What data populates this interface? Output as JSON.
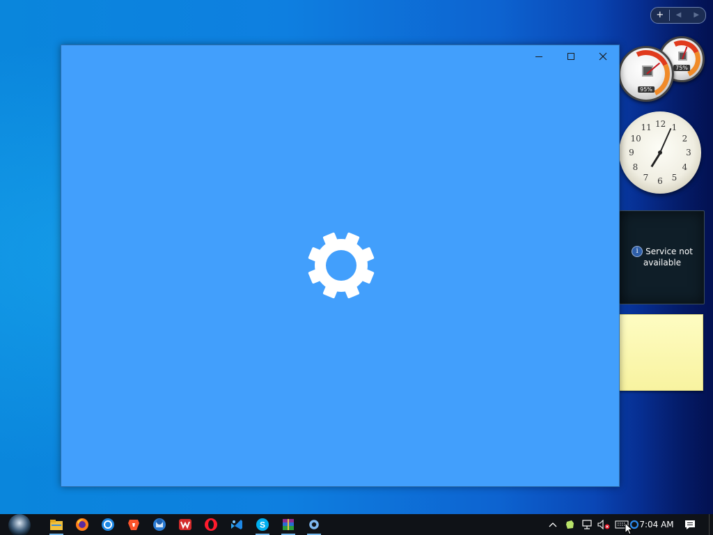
{
  "desktop": {
    "gadget_toolbar": {
      "add_label": "+",
      "prev_label": "◀",
      "next_label": "▶"
    },
    "meters": [
      {
        "percent": "95%"
      },
      {
        "percent": "75%"
      }
    ],
    "clock_gadget": {
      "numbers": [
        "12",
        "1",
        "2",
        "3",
        "4",
        "5",
        "6",
        "7",
        "8",
        "9",
        "10",
        "11"
      ],
      "hour": 7,
      "minute": 4
    },
    "weather_gadget": {
      "message": "Service not available",
      "info_glyph": "i"
    }
  },
  "window": {
    "background_color": "#429ffc",
    "controls": [
      "minimize",
      "maximize",
      "close"
    ],
    "splash_icon": "gear-icon"
  },
  "taskbar": {
    "apps": [
      {
        "name": "file-explorer-icon",
        "active": true
      },
      {
        "name": "firefox-icon",
        "active": false
      },
      {
        "name": "chrome-icon",
        "active": false
      },
      {
        "name": "brave-icon",
        "active": false
      },
      {
        "name": "thunderbird-icon",
        "active": false
      },
      {
        "name": "wps-office-icon",
        "active": false
      },
      {
        "name": "opera-icon",
        "active": false
      },
      {
        "name": "visual-studio-icon",
        "active": false
      },
      {
        "name": "skype-icon",
        "active": true
      },
      {
        "name": "winrar-icon",
        "active": true
      },
      {
        "name": "settings-app-icon",
        "active": true
      }
    ],
    "tray_icons": [
      "chevron-up-icon",
      "evernote-icon",
      "network-icon",
      "volume-muted-icon",
      "keyboard-icon",
      "cortana-icon"
    ],
    "time": "7:04 AM",
    "notification_icon": "action-center-icon"
  }
}
